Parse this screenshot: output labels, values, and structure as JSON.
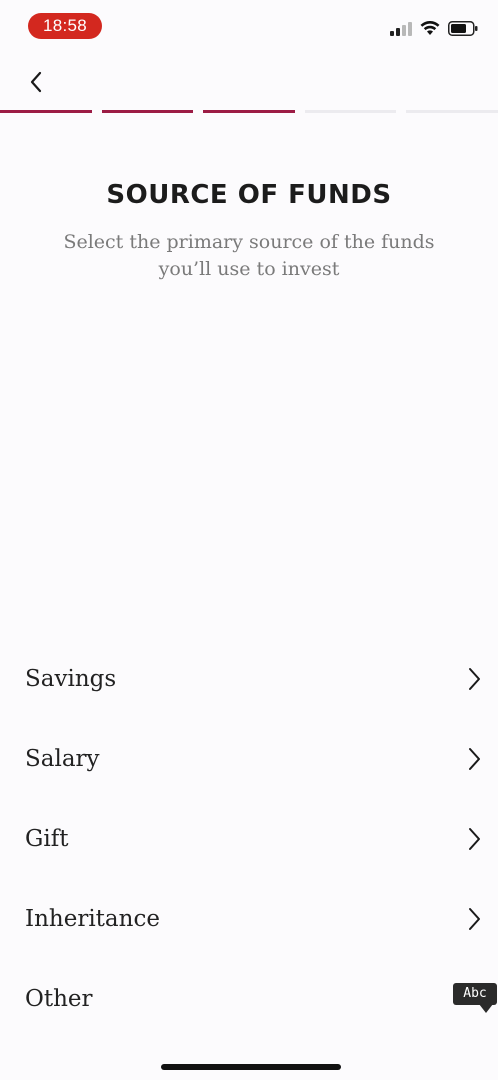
{
  "status_bar": {
    "time": "18:58",
    "time_pill_color": "#d3281f",
    "icons": [
      "signal-icon",
      "wifi-icon",
      "battery-icon"
    ]
  },
  "nav": {
    "back_icon": "chevron-left-icon"
  },
  "progress": {
    "total_steps": 5,
    "completed_steps": 3,
    "filled_color": "#9c1c45",
    "empty_color": "#ecebef"
  },
  "header": {
    "title": "SOURCE OF FUNDS",
    "subtitle_line1": "Select the primary source of the funds",
    "subtitle_line2": "you’ll use to invest"
  },
  "options": [
    {
      "label": "Savings"
    },
    {
      "label": "Salary"
    },
    {
      "label": "Gift"
    },
    {
      "label": "Inheritance"
    },
    {
      "label": "Other"
    }
  ],
  "overlay": {
    "abc_label": "Abc"
  }
}
